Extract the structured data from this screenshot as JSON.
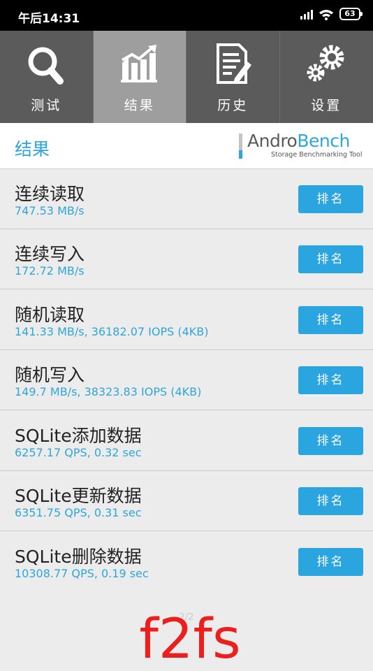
{
  "status_bar": {
    "time": "午后14:31",
    "battery": "63"
  },
  "tabs": [
    {
      "label": "测试",
      "icon": "search-icon"
    },
    {
      "label": "结果",
      "icon": "chart-icon",
      "active": true
    },
    {
      "label": "历史",
      "icon": "history-document-icon"
    },
    {
      "label": "设置",
      "icon": "gear-icon"
    }
  ],
  "header": {
    "title": "结果",
    "logo_part1": "Andro",
    "logo_part2": "Bench",
    "logo_tagline": "Storage Benchmarking Tool"
  },
  "results": [
    {
      "name": "连续读取",
      "value": "747.53 MB/s",
      "button": "排名"
    },
    {
      "name": "连续写入",
      "value": "172.72 MB/s",
      "button": "排名"
    },
    {
      "name": "随机读取",
      "value": "141.33 MB/s, 36182.07 IOPS (4KB)",
      "button": "排名"
    },
    {
      "name": "随机写入",
      "value": "149.7 MB/s, 38323.83 IOPS (4KB)",
      "button": "排名"
    },
    {
      "name": "SQLite添加数据",
      "value": "6257.17 QPS, 0.32 sec",
      "button": "排名"
    },
    {
      "name": "SQLite更新数据",
      "value": "6351.75 QPS, 0.31 sec",
      "button": "排名"
    },
    {
      "name": "SQLite删除数据",
      "value": "10308.77 QPS, 0.19 sec",
      "button": "排名"
    }
  ],
  "pager": "2/2",
  "watermark": "f2fs",
  "colors": {
    "accent": "#2fa6d9",
    "button": "#2aa5e0",
    "tab_bg": "#5b5b5b",
    "tab_active": "#9e9e9e",
    "watermark": "#ec1f1f"
  }
}
